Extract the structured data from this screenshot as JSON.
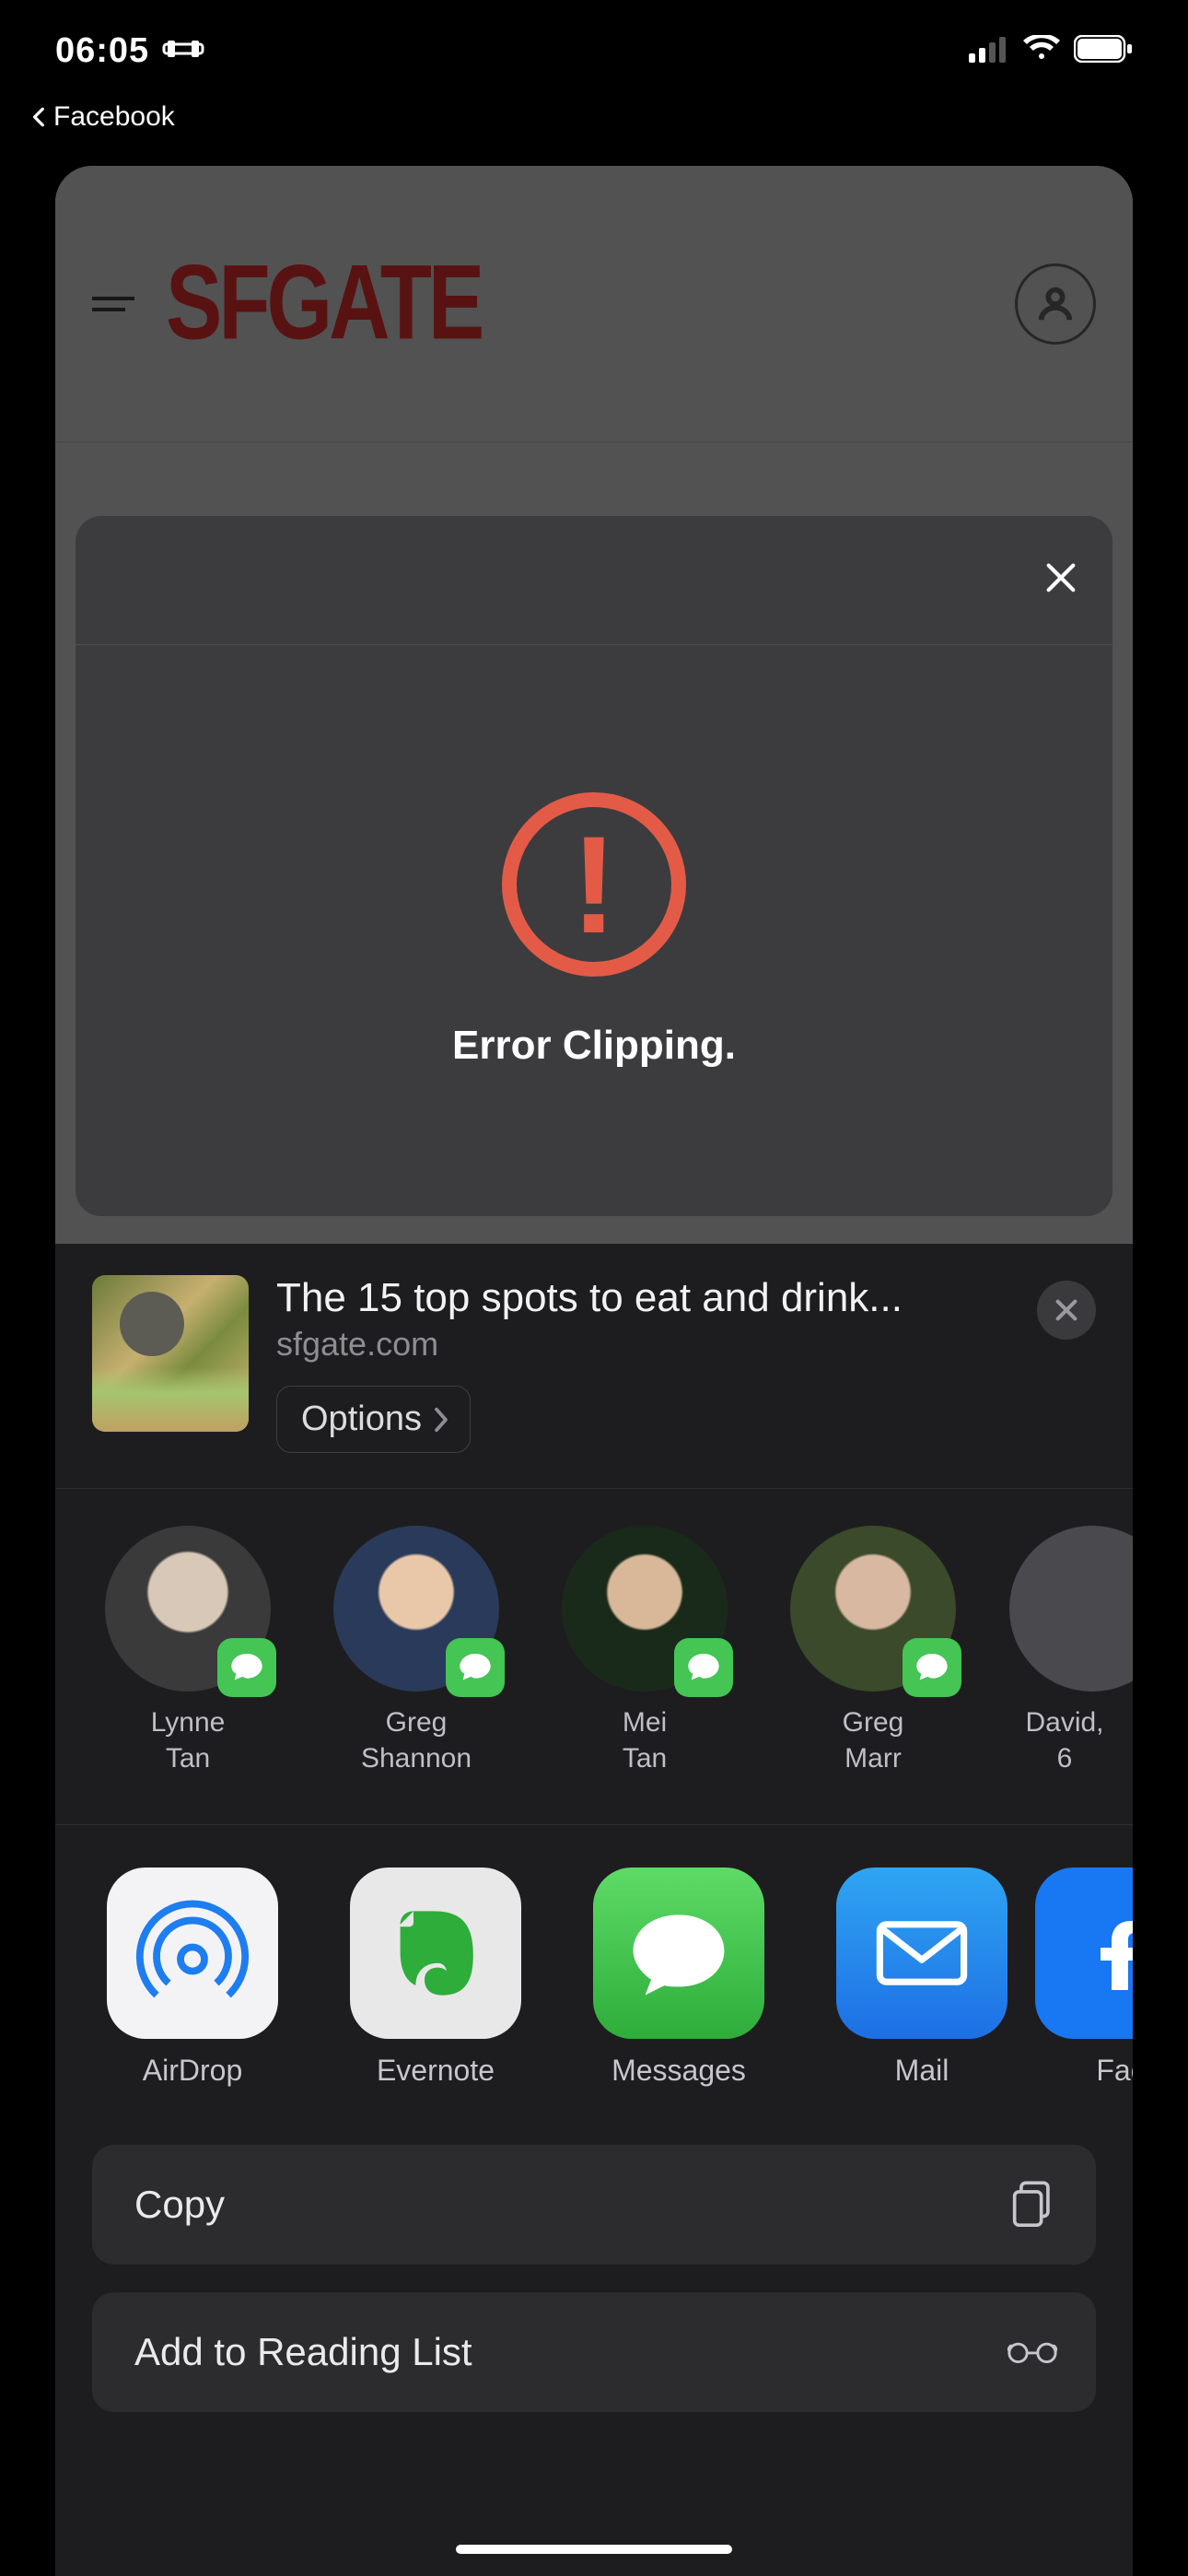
{
  "status": {
    "time": "06:05",
    "back_app": "Facebook"
  },
  "site": {
    "logo": "SFGATE"
  },
  "error_card": {
    "message": "Error Clipping."
  },
  "share": {
    "title": "The 15 top spots to eat and drink...",
    "domain": "sfgate.com",
    "options_label": "Options",
    "contacts": [
      {
        "name": "Lynne\nTan"
      },
      {
        "name": "Greg\nShannon"
      },
      {
        "name": "Mei\nTan"
      },
      {
        "name": "Greg\nMarr"
      },
      {
        "name": "David,\n6"
      }
    ],
    "apps": [
      {
        "label": "AirDrop"
      },
      {
        "label": "Evernote"
      },
      {
        "label": "Messages"
      },
      {
        "label": "Mail"
      },
      {
        "label": "Fac"
      }
    ],
    "actions": {
      "copy": "Copy",
      "reading_list": "Add to Reading List"
    }
  }
}
